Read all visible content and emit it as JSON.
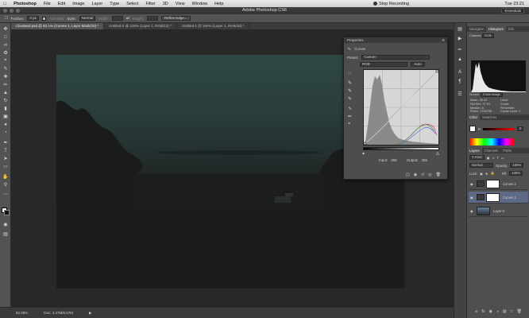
{
  "menubar": {
    "apple_icon": "apple-logo",
    "items": [
      "Photoshop",
      "File",
      "Edit",
      "Image",
      "Layer",
      "Type",
      "Select",
      "Filter",
      "3D",
      "View",
      "Window",
      "Help"
    ],
    "recording_label": "Stop Recording",
    "clock": "Tue 23:21"
  },
  "window": {
    "title": "Adobe Photoshop CS6",
    "workspace": "Essentials"
  },
  "options": {
    "feather_label": "Feather:",
    "feather_value": "0 px",
    "antialias_label": "Anti-alias",
    "style_label": "Style:",
    "style_value": "Normal",
    "width_label": "Width:",
    "height_label": "Height:",
    "refine_label": "Refine Edge..."
  },
  "tabs": [
    "Cliveland.psd @ 82.1% (Curves 1, Layer Mask/16) *",
    "Untitled-2 @ 100% (Layer 1, RGB/16) *",
    "Untitled-1 @ 100% (Layer 1, RGB/16) *"
  ],
  "status": {
    "zoom": "82.08%",
    "doc": "Doc: 4.47M/8.57M"
  },
  "properties": {
    "title": "Properties",
    "adjust_name": "Curves",
    "preset_label": "Preset:",
    "preset_value": "Custom",
    "channel_value": "RGB",
    "auto_label": "Auto",
    "input_label": "Input:",
    "input_value": "255",
    "output_label": "Output:",
    "output_value": "255",
    "curve_color": "#cfcfcf"
  },
  "histogram_panel": {
    "tabs": [
      "Navigator",
      "Histogram",
      "Info"
    ],
    "channel_label": "Channel:",
    "channel_value": "RGB",
    "source_label": "Source:",
    "source_value": "Entire Image",
    "stats": [
      {
        "label": "Mean:",
        "value": "36.03",
        "label2": "Level:",
        "value2": ""
      },
      {
        "label": "Std Dev:",
        "value": "37.91",
        "label2": "Count:",
        "value2": ""
      },
      {
        "label": "Median:",
        "value": "8",
        "label2": "Percentile:",
        "value2": ""
      },
      {
        "label": "Pixels:",
        "value": "2720736",
        "label2": "Cache Level:",
        "value2": "2"
      }
    ]
  },
  "color_panel": {
    "tabs": [
      "Color",
      "Swatches"
    ],
    "r_label": "R",
    "value": "0"
  },
  "layers_panel": {
    "tabs": [
      "Layers",
      "Channels",
      "Paths"
    ],
    "kind_label": "Kind",
    "blend_value": "Normal",
    "opacity_label": "Opacity:",
    "opacity_value": "100%",
    "lock_label": "Lock:",
    "fill_label": "Fill:",
    "fill_value": "100%",
    "layers": [
      {
        "name": "Curves 2"
      },
      {
        "name": "Curves 1"
      },
      {
        "name": "Layer 0"
      }
    ]
  }
}
